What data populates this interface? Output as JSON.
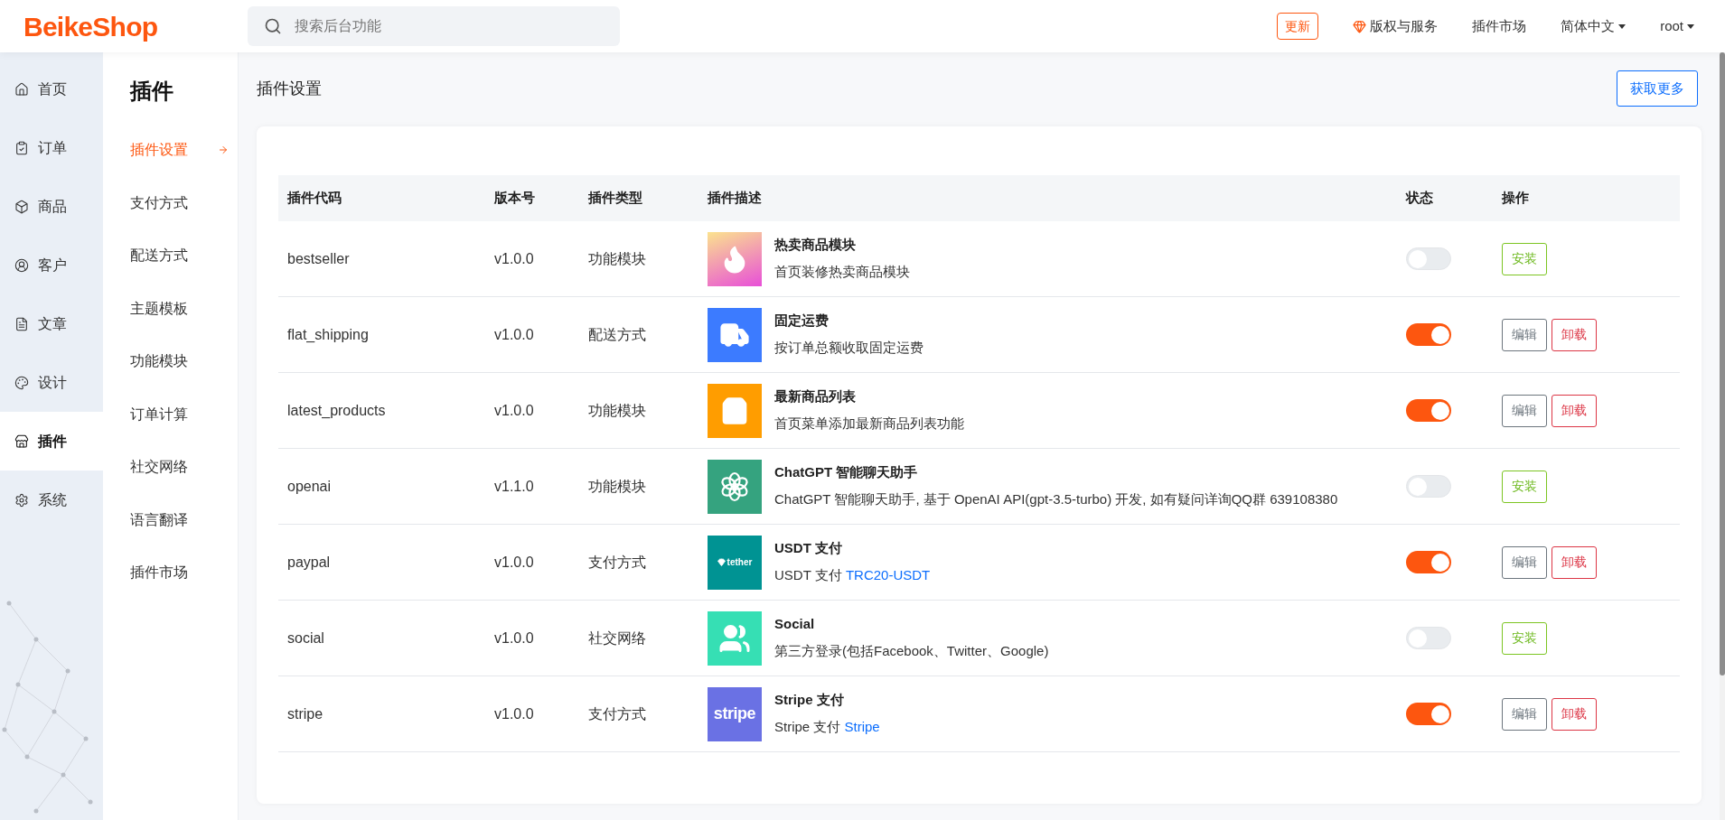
{
  "header": {
    "logo": "BeikeShop",
    "search": {
      "placeholder": "搜索后台功能"
    },
    "links": [
      {
        "label": "更新",
        "kind": "badge"
      },
      {
        "label": "版权与服务",
        "kind": "gem"
      },
      {
        "label": "插件市场",
        "kind": "plain"
      },
      {
        "label": "简体中文",
        "kind": "dropdown"
      },
      {
        "label": "root",
        "kind": "dropdown"
      }
    ]
  },
  "sidebar": {
    "items": [
      {
        "label": "首页",
        "selected": false
      },
      {
        "label": "订单",
        "selected": false
      },
      {
        "label": "商品",
        "selected": false
      },
      {
        "label": "客户",
        "selected": false
      },
      {
        "label": "文章",
        "selected": false
      },
      {
        "label": "设计",
        "selected": false
      },
      {
        "label": "插件",
        "selected": true
      },
      {
        "label": "系统",
        "selected": false
      }
    ]
  },
  "subnav": {
    "title": "插件",
    "items": [
      {
        "label": "插件设置",
        "selected": true
      },
      {
        "label": "支付方式",
        "selected": false
      },
      {
        "label": "配送方式",
        "selected": false
      },
      {
        "label": "主题模板",
        "selected": false
      },
      {
        "label": "功能模块",
        "selected": false
      },
      {
        "label": "订单计算",
        "selected": false
      },
      {
        "label": "社交网络",
        "selected": false
      },
      {
        "label": "语言翻译",
        "selected": false
      },
      {
        "label": "插件市场",
        "selected": false
      }
    ]
  },
  "page": {
    "title": "插件设置",
    "more_button": "获取更多"
  },
  "table": {
    "columns": [
      "插件代码",
      "版本号",
      "插件类型",
      "插件描述",
      "状态",
      "操作"
    ],
    "rows": [
      {
        "code": "bestseller",
        "version": "v1.0.0",
        "type": "功能模块",
        "icon": {
          "kind": "flame"
        },
        "name": "热卖商品模块",
        "description": "首页装修热卖商品模块",
        "enabled": false,
        "actions": [
          {
            "label": "安装",
            "kind": "install"
          }
        ]
      },
      {
        "code": "flat_shipping",
        "version": "v1.0.0",
        "type": "配送方式",
        "icon": {
          "kind": "truck"
        },
        "name": "固定运费",
        "description": "按订单总额收取固定运费",
        "enabled": true,
        "actions": [
          {
            "label": "编辑",
            "kind": "edit"
          },
          {
            "label": "卸载",
            "kind": "uninstall"
          }
        ]
      },
      {
        "code": "latest_products",
        "version": "v1.0.0",
        "type": "功能模块",
        "icon": {
          "kind": "bag"
        },
        "name": "最新商品列表",
        "description": "首页菜单添加最新商品列表功能",
        "enabled": true,
        "actions": [
          {
            "label": "编辑",
            "kind": "edit"
          },
          {
            "label": "卸载",
            "kind": "uninstall"
          }
        ]
      },
      {
        "code": "openai",
        "version": "v1.1.0",
        "type": "功能模块",
        "icon": {
          "kind": "knot"
        },
        "name": "ChatGPT 智能聊天助手",
        "description": "ChatGPT 智能聊天助手, 基于 OpenAI API(gpt-3.5-turbo) 开发, 如有疑问详询QQ群 639108380",
        "enabled": false,
        "actions": [
          {
            "label": "安装",
            "kind": "install"
          }
        ]
      },
      {
        "code": "paypal",
        "version": "v1.0.0",
        "type": "支付方式",
        "icon": {
          "kind": "gem_wordmark",
          "text": "tether"
        },
        "name": "USDT 支付",
        "description": "USDT 支付",
        "link": "TRC20-USDT",
        "enabled": true,
        "actions": [
          {
            "label": "编辑",
            "kind": "edit"
          },
          {
            "label": "卸载",
            "kind": "uninstall"
          }
        ]
      },
      {
        "code": "social",
        "version": "v1.0.0",
        "type": "社交网络",
        "icon": {
          "kind": "users"
        },
        "name": "Social",
        "description": "第三方登录(包括Facebook、Twitter、Google)",
        "enabled": false,
        "actions": [
          {
            "label": "安装",
            "kind": "install"
          }
        ]
      },
      {
        "code": "stripe",
        "version": "v1.0.0",
        "type": "支付方式",
        "icon": {
          "kind": "wordmark",
          "text": "stripe"
        },
        "name": "Stripe 支付",
        "description": "Stripe 支付",
        "link": "Stripe",
        "enabled": true,
        "actions": [
          {
            "label": "编辑",
            "kind": "edit"
          },
          {
            "label": "卸载",
            "kind": "uninstall"
          }
        ]
      }
    ]
  }
}
